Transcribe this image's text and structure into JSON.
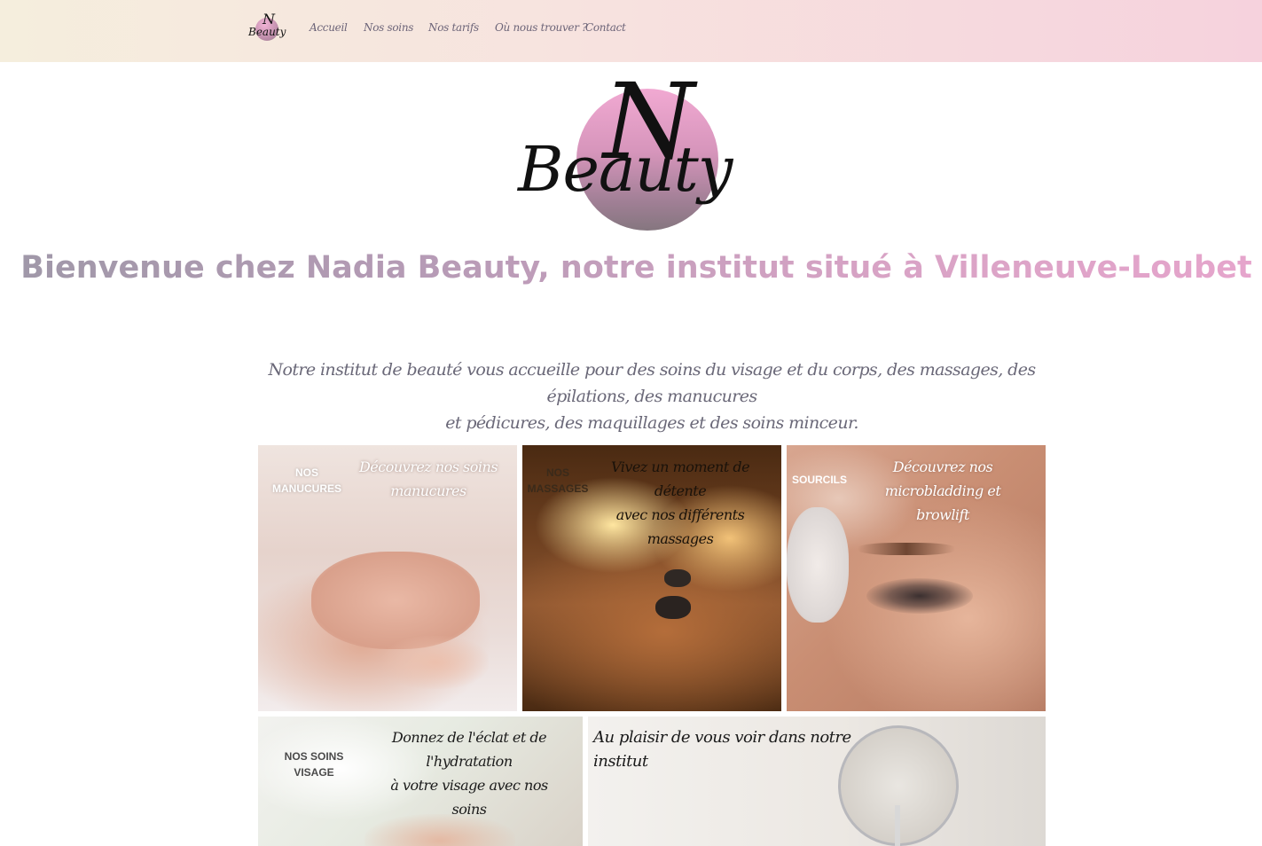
{
  "nav": {
    "logo_letter": "N",
    "logo_word": "Beauty",
    "items": [
      "Accueil",
      "Nos soins",
      "Nos tarifs",
      "Où nous trouver ?",
      "Contact"
    ]
  },
  "hero": {
    "logo_letter": "N",
    "logo_word": "Beauty"
  },
  "headline": "Bienvenue chez Nadia Beauty, notre institut situé à Villeneuve-Loubet",
  "intro": {
    "line1": "Notre institut de beauté vous accueille pour des soins du visage et du corps, des massages, des épilations, des manucures",
    "line2": "et pédicures, des maquillages et des soins minceur."
  },
  "tiles": [
    {
      "tag_line1": "NOS",
      "tag_line2": "MANUCURES",
      "caption_line1": "Découvrez nos soins",
      "caption_line2": "manucures"
    },
    {
      "tag_line1": "NOS",
      "tag_line2": "MASSAGES",
      "caption_line1": "Vivez un moment de détente",
      "caption_line2": "avec nos différents massages"
    },
    {
      "tag_line1": "SOURCILS",
      "caption_line1": "Découvrez nos microbladding et",
      "caption_line2": "browlift"
    },
    {
      "tag_line1": "NOS SOINS",
      "tag_line2": "VISAGE",
      "caption_line1": "Donnez de l'éclat et de",
      "caption_line2": "l'hydratation",
      "caption_line3": "à votre visage avec nos soins"
    },
    {
      "caption_line1": "Au plaisir de vous voir dans notre institut"
    }
  ],
  "colors": {
    "header_gradient_start": "#f5eedd",
    "header_gradient_end": "#f6d2dd",
    "headline_start": "#9f98a8",
    "headline_end": "#e6a5cc",
    "body_text": "#6a6878"
  }
}
